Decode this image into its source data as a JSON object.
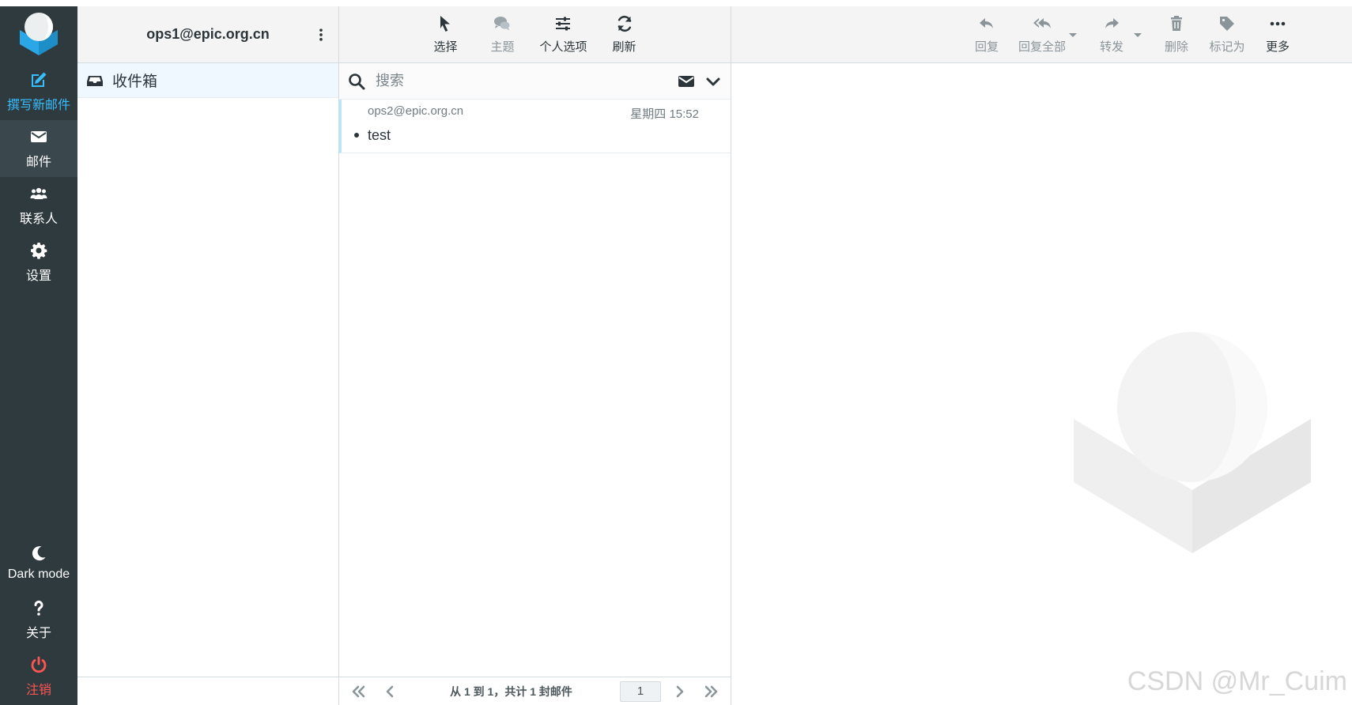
{
  "sidebar": {
    "compose_label": "撰写新邮件",
    "mail_label": "邮件",
    "contacts_label": "联系人",
    "settings_label": "设置",
    "darkmode_label": "Dark mode",
    "about_label": "关于",
    "logout_label": "注销"
  },
  "account": {
    "email": "ops1@epic.org.cn"
  },
  "folders": {
    "items": [
      {
        "label": "收件箱"
      }
    ]
  },
  "list_toolbar": {
    "select_label": "选择",
    "threads_label": "主题",
    "options_label": "个人选项",
    "refresh_label": "刷新"
  },
  "search": {
    "placeholder": "搜索"
  },
  "messages": [
    {
      "from": "ops2@epic.org.cn",
      "date": "星期四 15:52",
      "subject": "test"
    }
  ],
  "pagination": {
    "summary": "从 1 到 1，共计 1 封邮件",
    "page": "1"
  },
  "preview_toolbar": {
    "reply_label": "回复",
    "reply_all_label": "回复全部",
    "forward_label": "转发",
    "delete_label": "删除",
    "mark_label": "标记为",
    "more_label": "更多"
  },
  "watermark_text": "CSDN @Mr_Cuim",
  "colors": {
    "sidebar_bg": "#2f3a3f",
    "accent": "#37beff",
    "danger": "#ff5552"
  }
}
